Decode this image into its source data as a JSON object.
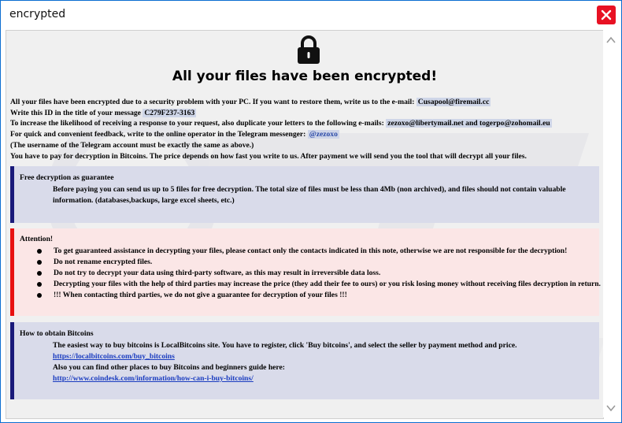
{
  "window": {
    "title": "encrypted"
  },
  "headline": "All your files have been encrypted!",
  "intro": {
    "line1_text": "All your files have been encrypted due to a security problem with your PC. If you want to restore them, write us to the e-mail:",
    "line1_email": "Cusapool@firemail.cc",
    "line2_text": "Write this ID in the title of your message",
    "line2_id": "C279F237-3163",
    "line3_text": "To increase the likelihood of receiving a response to your request, also duplicate your letters to the following e-mails:",
    "line3_emails": "zezoxo@libertymail.net and togerpo@zohomail.eu",
    "line4_text": "For quick and convenient feedback, write to the online operator in the Telegram messenger:",
    "line4_telegram": "@zezoxo",
    "line5_text": "(The username of the Telegram account must be exactly the same as above.)",
    "line6_text": "You have to pay for decryption in Bitcoins. The price depends on how fast you write to us. After payment we will send you the tool that will decrypt all your files."
  },
  "guarantee": {
    "title": "Free decryption as guarantee",
    "line1": "Before paying you can send us up to 5 files for free decryption. The total size of files must be less than 4Mb (non archived), and files should not contain valuable",
    "line2": "information. (databases,backups, large excel sheets, etc.)"
  },
  "attention": {
    "title": "Attention!",
    "items": [
      "To get guaranteed assistance in decrypting your files, please contact only the contacts indicated in this note, otherwise we are not responsible for the decryption!",
      "Do not rename encrypted files.",
      "Do not try to decrypt your data using third-party software, as this may result in irreversible data loss.",
      "Decrypting your files with the help of third parties may increase the price (they add their fee to ours) or you risk losing money without receiving files decryption in return.",
      "!!! When contacting third parties, we do not give a guarantee for decryption of your files !!!"
    ]
  },
  "bitcoins": {
    "title": "How to obtain Bitcoins",
    "line1": "The easiest way to buy bitcoins is LocalBitcoins site. You have to register, click 'Buy bitcoins', and select the seller by payment method and price.",
    "link1": "https://localbitcoins.com/buy_bitcoins",
    "line2": "Also you can find other places to buy Bitcoins and beginners guide here:",
    "link2": "http://www.coindesk.com/information/how-can-i-buy-bitcoins/"
  },
  "icons": {
    "lock": "lock-icon",
    "close": "close-icon",
    "scroll_up": "scroll-up-arrow-icon",
    "scroll_down": "scroll-down-arrow-icon"
  },
  "colors": {
    "window_border": "#0b6ed1",
    "close_button": "#e81123",
    "blue_box_bar": "#1a1a7a",
    "red_box_bar": "#e81010",
    "link": "#1a3cc0"
  }
}
